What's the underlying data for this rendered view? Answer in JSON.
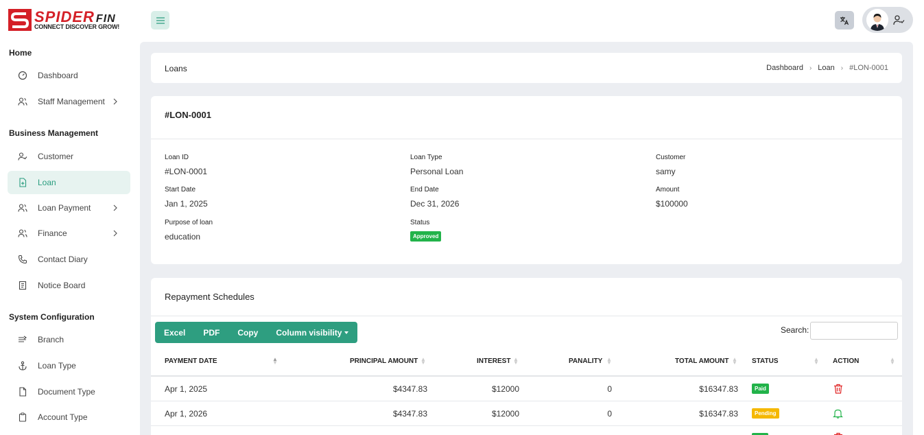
{
  "brand": {
    "name": "SPIDER",
    "suffix": "FIN",
    "tagline": "CONNECT DISCOVER GROW!"
  },
  "sidebar": {
    "sections": [
      {
        "title": "Home"
      },
      {
        "title": "Business Management"
      },
      {
        "title": "System Configuration"
      }
    ],
    "items": [
      {
        "label": "Dashboard",
        "icon": "dashboard-icon"
      },
      {
        "label": "Staff Management",
        "icon": "users-icon"
      },
      {
        "label": "Customer",
        "icon": "user-check-icon"
      },
      {
        "label": "Loan",
        "icon": "file-plus-icon"
      },
      {
        "label": "Loan Payment",
        "icon": "users-icon"
      },
      {
        "label": "Finance",
        "icon": "users-icon"
      },
      {
        "label": "Contact Diary",
        "icon": "phone-icon"
      },
      {
        "label": "Notice Board",
        "icon": "notice-icon"
      },
      {
        "label": "Branch",
        "icon": "branch-icon"
      },
      {
        "label": "Loan Type",
        "icon": "anchor-icon"
      },
      {
        "label": "Document Type",
        "icon": "document-icon"
      },
      {
        "label": "Account Type",
        "icon": "clipboard-icon"
      }
    ]
  },
  "topbar": {
    "lang_label": "A"
  },
  "breadcrumb": {
    "title": "Loans",
    "trail": [
      "Dashboard",
      "Loan",
      "#LON-0001"
    ]
  },
  "loan": {
    "heading": "#LON-0001",
    "fields": {
      "loan_id_label": "Loan ID",
      "loan_id": "#LON-0001",
      "loan_type_label": "Loan Type",
      "loan_type": "Personal Loan",
      "customer_label": "Customer",
      "customer": "samy",
      "start_label": "Start Date",
      "start": "Jan 1, 2025",
      "end_label": "End Date",
      "end": "Dec 31, 2026",
      "amount_label": "Amount",
      "amount": "$100000",
      "purpose_label": "Purpose of loan",
      "purpose": "education",
      "status_label": "Status",
      "status": "Approved"
    }
  },
  "repayment": {
    "heading": "Repayment Schedules",
    "buttons": {
      "excel": "Excel",
      "pdf": "PDF",
      "copy": "Copy",
      "colvis": "Column visibility"
    },
    "search_label": "Search:",
    "columns": [
      "PAYMENT DATE",
      "PRINCIPAL AMOUNT",
      "INTEREST",
      "PANALITY",
      "TOTAL AMOUNT",
      "STATUS",
      "ACTION"
    ],
    "rows": [
      {
        "date": "Apr 1, 2025",
        "principal": "$4347.83",
        "interest": "$12000",
        "penalty": "0",
        "total": "$16347.83",
        "status": "Paid"
      },
      {
        "date": "Apr 1, 2026",
        "principal": "$4347.83",
        "interest": "$12000",
        "penalty": "0",
        "total": "$16347.83",
        "status": "Pending"
      }
    ]
  }
}
